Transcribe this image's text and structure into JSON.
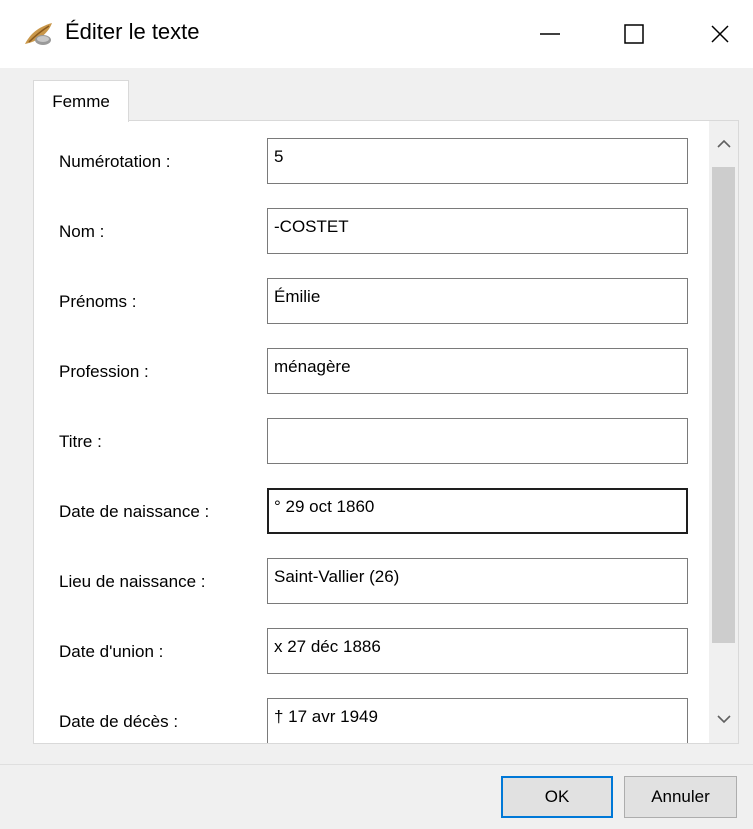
{
  "window": {
    "title": "Éditer le texte",
    "icon": "quill-feather-icon",
    "controls": [
      "minimize-icon",
      "maximize-icon",
      "close-icon"
    ]
  },
  "tab": {
    "label": "Femme"
  },
  "fields": [
    {
      "label": "Numérotation :",
      "value": "5"
    },
    {
      "label": "Nom :",
      "value": "-COSTET"
    },
    {
      "label": "Prénoms :",
      "value": "Émilie"
    },
    {
      "label": "Profession :",
      "value": "ménagère"
    },
    {
      "label": "Titre :",
      "value": ""
    },
    {
      "label": "Date de naissance :",
      "value": "° 29 oct 1860"
    },
    {
      "label": "Lieu de naissance :",
      "value": "Saint-Vallier (26)"
    },
    {
      "label": "Date d'union :",
      "value": "x 27 déc 1886"
    },
    {
      "label": "Date de décès :",
      "value": "† 17 avr 1949"
    }
  ],
  "buttons": {
    "ok": "OK",
    "cancel": "Annuler"
  },
  "colors": {
    "default_button_border": "#0078d7",
    "scroll_thumb": "#cdcdcd"
  }
}
